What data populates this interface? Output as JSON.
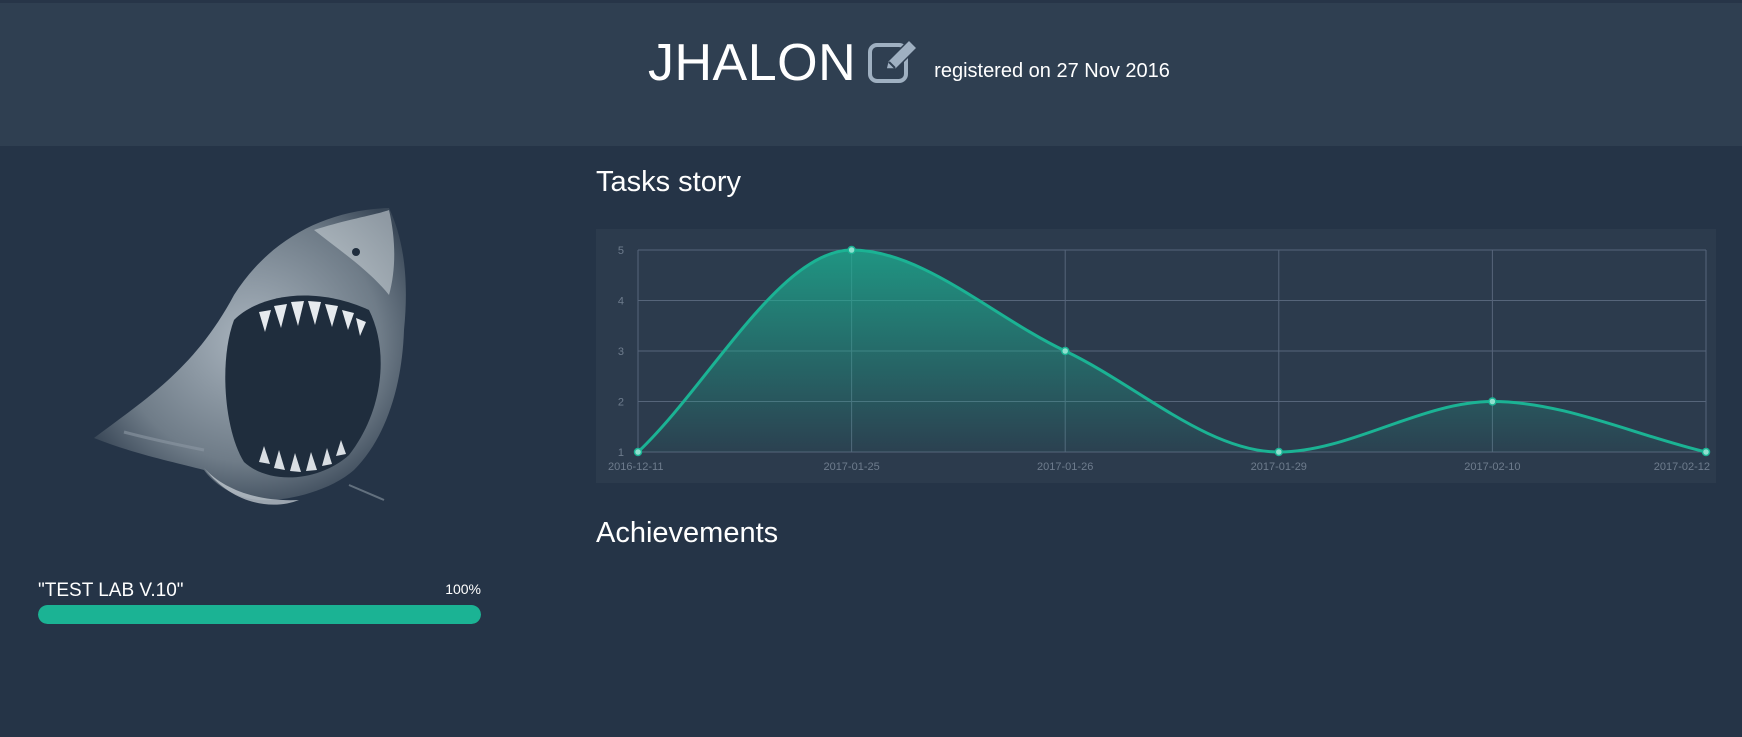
{
  "profile": {
    "username": "JHALON",
    "registered": "registered on 27 Nov 2016",
    "edit_icon": "edit-icon",
    "avatar": "shark-avatar-image"
  },
  "progress": {
    "title": "\"TEST LAB V.10\"",
    "percent_label": "100%",
    "value": 100,
    "color": "#1bb394"
  },
  "sections": {
    "tasks_story": "Tasks story",
    "achievements": "Achievements"
  },
  "chart_data": {
    "type": "line",
    "categories": [
      "2016-12-11",
      "2017-01-25",
      "2017-01-26",
      "2017-01-29",
      "2017-02-10",
      "2017-02-12"
    ],
    "series": [
      {
        "values": [
          1,
          5,
          3,
          1,
          2,
          1
        ]
      }
    ],
    "yticks": [
      1,
      2,
      3,
      4,
      5
    ],
    "ylim": [
      1,
      5
    ],
    "grid": true,
    "smooth": true,
    "fill": "area",
    "line_color": "#1bb394",
    "title": "",
    "xlabel": "",
    "ylabel": ""
  },
  "colors": {
    "background": "#253447",
    "header": "#2f3f51",
    "chart_background": "#2c3b4d",
    "accent": "#1bb394"
  }
}
